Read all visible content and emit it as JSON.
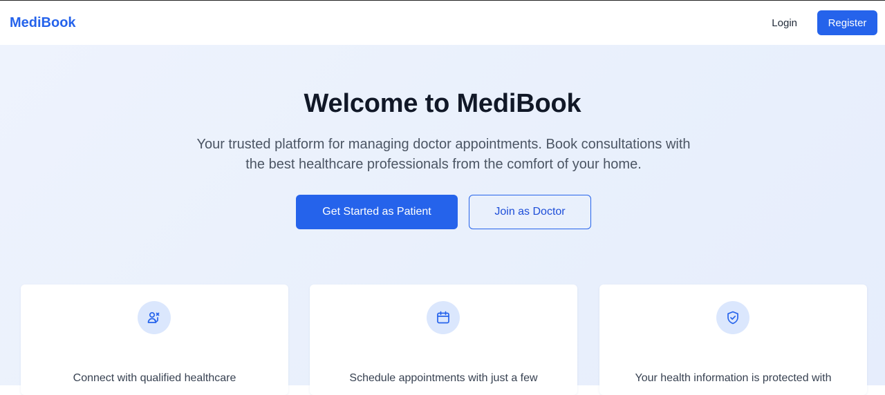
{
  "nav": {
    "brand": "MediBook",
    "login_label": "Login",
    "register_label": "Register"
  },
  "hero": {
    "title": "Welcome to MediBook",
    "subtitle": "Your trusted platform for managing doctor appointments. Book consultations with the best healthcare professionals from the comfort of your home.",
    "primary_cta": "Get Started as Patient",
    "secondary_cta": "Join as Doctor"
  },
  "features": [
    {
      "icon": "doctor-stethoscope-icon",
      "text": "Connect with qualified healthcare"
    },
    {
      "icon": "calendar-icon",
      "text": "Schedule appointments with just a few"
    },
    {
      "icon": "shield-check-icon",
      "text": "Your health information is protected with"
    }
  ],
  "colors": {
    "accent": "#2563eb",
    "hero_bg": "#eaf1fd",
    "icon_bg": "#dbe7fd"
  }
}
